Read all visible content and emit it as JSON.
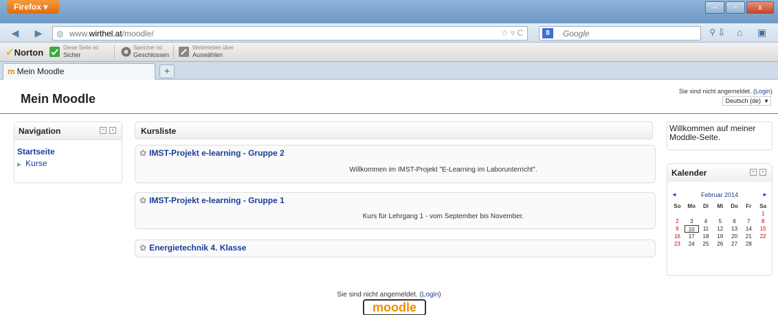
{
  "browser": {
    "menu_label": "Firefox ▾",
    "url_prefix": "www.",
    "url_domain": "wirthel.at",
    "url_path": "/moodle/",
    "search_engine_icon": "8",
    "search_placeholder": "Google",
    "tab_label": "Mein Moodle",
    "new_tab_label": "+",
    "window_controls": [
      "–",
      "▫",
      "x"
    ]
  },
  "norton": {
    "brand": "Norton",
    "items": [
      {
        "top": "Diese Seite ist",
        "bottom": "Sicher"
      },
      {
        "top": "Speicher ist",
        "bottom": "Geschlossen"
      },
      {
        "top": "Weiterleiten über",
        "bottom": "Auswählen"
      }
    ]
  },
  "page": {
    "title": "Mein Moodle",
    "login_status_prefix": "Sie sind nicht angemeldet. (",
    "login_link": "Login",
    "login_status_suffix": ")",
    "language": "Deutsch (de)"
  },
  "navigation": {
    "title": "Navigation",
    "home": "Startseite",
    "courses": "Kurse"
  },
  "course_list": {
    "title": "Kursliste",
    "courses": [
      {
        "name": "IMST-Projekt e-learning - Gruppe 2",
        "description": "Willkommen im IMST-Projekt \"E-Learning im Laborunterricht\"."
      },
      {
        "name": "IMST-Projekt e-learning - Gruppe 1",
        "description": "Kurs für Lehrgang 1 - vom September bis November."
      },
      {
        "name": "Energietechnik 4. Klasse",
        "description": ""
      }
    ]
  },
  "welcome": {
    "text": "Willkommen auf meiner Moddle-Seite."
  },
  "calendar": {
    "title": "Kalender",
    "month": "Februar 2014",
    "prev": "◄",
    "next": "►",
    "weekdays": [
      "So",
      "Mo",
      "Di",
      "Mi",
      "Do",
      "Fr",
      "Sa"
    ],
    "weeks": [
      [
        "",
        "",
        "",
        "",
        "",
        "",
        "1"
      ],
      [
        "2",
        "3",
        "4",
        "5",
        "6",
        "7",
        "8"
      ],
      [
        "9",
        "10",
        "11",
        "12",
        "13",
        "14",
        "15"
      ],
      [
        "16",
        "17",
        "18",
        "19",
        "20",
        "21",
        "22"
      ],
      [
        "23",
        "24",
        "25",
        "26",
        "27",
        "28",
        ""
      ]
    ],
    "today": "10"
  },
  "footer": {
    "prefix": "Sie sind nicht angemeldet. (",
    "login_link": "Login",
    "suffix": ")",
    "logo_text": "moodle"
  }
}
